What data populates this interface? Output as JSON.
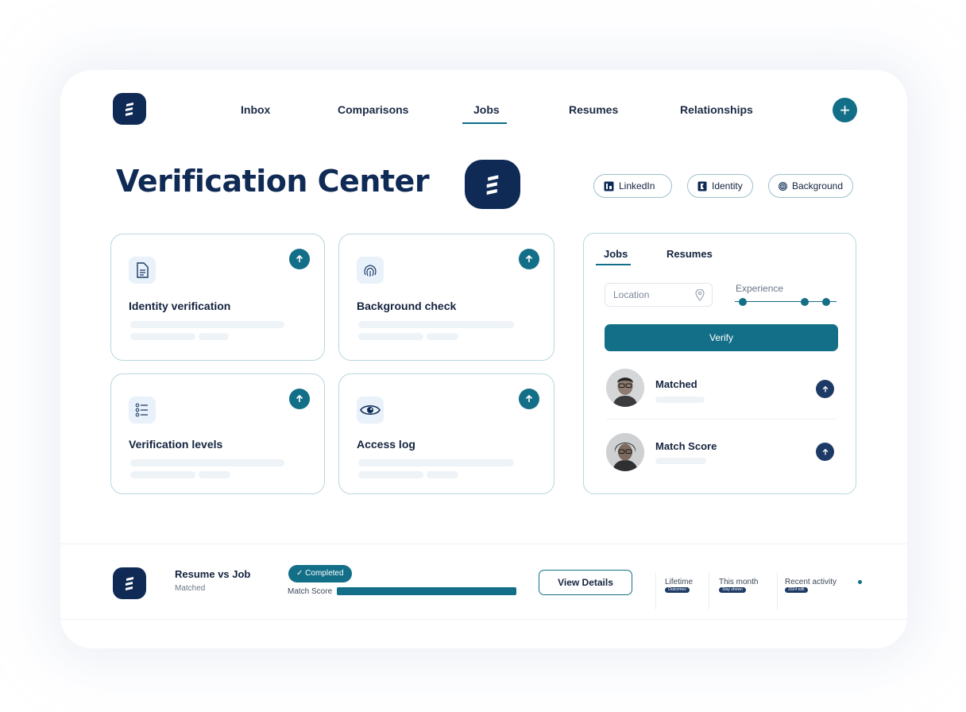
{
  "nav": {
    "items": [
      "Inbox",
      "Comparisons",
      "Jobs",
      "Resumes",
      "Relationships"
    ],
    "active": "Jobs",
    "add_icon": "plus-icon"
  },
  "page": {
    "title": "Verification Center"
  },
  "pills": [
    {
      "label": "LinkedIn",
      "icon": "linkedin-icon"
    },
    {
      "label": "Identity",
      "icon": "id-badge-icon"
    },
    {
      "label": "Background",
      "icon": "fingerprint-icon"
    }
  ],
  "cards": [
    {
      "label": "Identity verification",
      "icon": "document-icon"
    },
    {
      "label": "Background check",
      "icon": "fingerprint-icon"
    },
    {
      "label": "Verification levels",
      "icon": "list-icon"
    },
    {
      "label": "Access log",
      "icon": "eye-icon"
    }
  ],
  "panel": {
    "tabs": [
      "Jobs",
      "Resumes"
    ],
    "active_tab": "Jobs",
    "location_placeholder": "Location",
    "experience_label": "Experience",
    "verify_label": "Verify",
    "results": [
      {
        "label": "Matched"
      },
      {
        "label": "Match Score"
      }
    ]
  },
  "bottom": {
    "title": "Resume vs Job",
    "subtitle": "Matched",
    "status_badge": "Completed",
    "match_score_label": "Match Score",
    "match_score_fill": 1.0,
    "view_details_label": "View Details",
    "stats": [
      {
        "label": "Lifetime",
        "chip": "Outcomes"
      },
      {
        "label": "This month",
        "chip": "Stay shown"
      },
      {
        "label": "Recent activity",
        "chip": "2024 edit"
      }
    ]
  },
  "colors": {
    "accent": "#136f88",
    "navy": "#0f2a55",
    "muted_skeleton": "#eef3f8"
  }
}
